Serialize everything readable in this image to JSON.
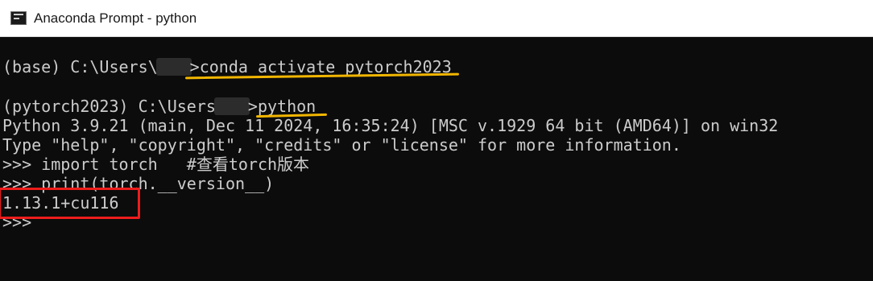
{
  "window": {
    "title": "Anaconda Prompt - python"
  },
  "console": {
    "lines": [
      {
        "prefix": "(base) C:\\Users\\",
        "text": ">conda activate pytorch2023"
      },
      {
        "prefix": "(pytorch2023) C:\\Users",
        "text": ">python"
      },
      {
        "text": "Python 3.9.21 (main, Dec 11 2024, 16:35:24) [MSC v.1929 64 bit (AMD64)] on win32"
      },
      {
        "text": "Type \"help\", \"copyright\", \"credits\" or \"license\" for more information."
      },
      {
        "text": ">>> import torch   #查看torch版本"
      },
      {
        "text": ">>> print(torch.__version__)"
      },
      {
        "text": "1.13.1+cu116"
      },
      {
        "text": ">>>"
      }
    ]
  },
  "annotations": {
    "underline_color": "#f2b600",
    "box_color": "#ee1c1c"
  }
}
